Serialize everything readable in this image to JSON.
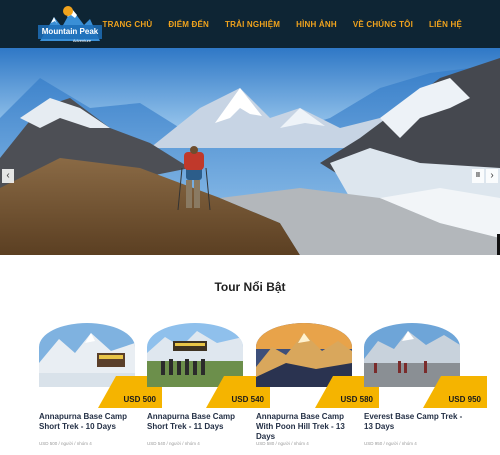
{
  "brand": {
    "logo_line1": "Mountain Peak",
    "logo_line2": "Adventure"
  },
  "nav": {
    "items": [
      {
        "label": "TRANG CHỦ",
        "name": "nav-trang-chu"
      },
      {
        "label": "ĐIỂM ĐẾN",
        "name": "nav-diem-den"
      },
      {
        "label": "TRẢI NGHIỆM",
        "name": "nav-trai-nghiem"
      },
      {
        "label": "HÌNH ẢNH",
        "name": "nav-hinh-anh"
      },
      {
        "label": "VỀ CHÚNG TÔI",
        "name": "nav-ve-chung-toi"
      },
      {
        "label": "LIÊN HỆ",
        "name": "nav-lien-he"
      }
    ]
  },
  "slider": {
    "prev_icon": "‹",
    "next_icon": "›",
    "pause_icon": "II"
  },
  "featured": {
    "title": "Tour Nổi Bật",
    "cards": [
      {
        "title": "Annapurna Base Camp Short Trek - 10 Days",
        "price": "USD 500",
        "sub": "USD 500 / người / nhóm 4"
      },
      {
        "title": "Annapurna Base Camp Short Trek - 11 Days",
        "price": "USD 540",
        "sub": "USD 540 / người / nhóm 4"
      },
      {
        "title": "Annapurna Base Camp With Poon Hill Trek - 13 Days",
        "price": "USD 580",
        "sub": "USD 580 / người / nhóm 4"
      },
      {
        "title": "Everest Base Camp Trek - 13 Days",
        "price": "USD 950",
        "sub": "USD 950 / người / nhóm 4"
      }
    ]
  },
  "colors": {
    "header_bg": "#0e2534",
    "accent": "#f0a31d",
    "price_tab": "#f5b400"
  }
}
